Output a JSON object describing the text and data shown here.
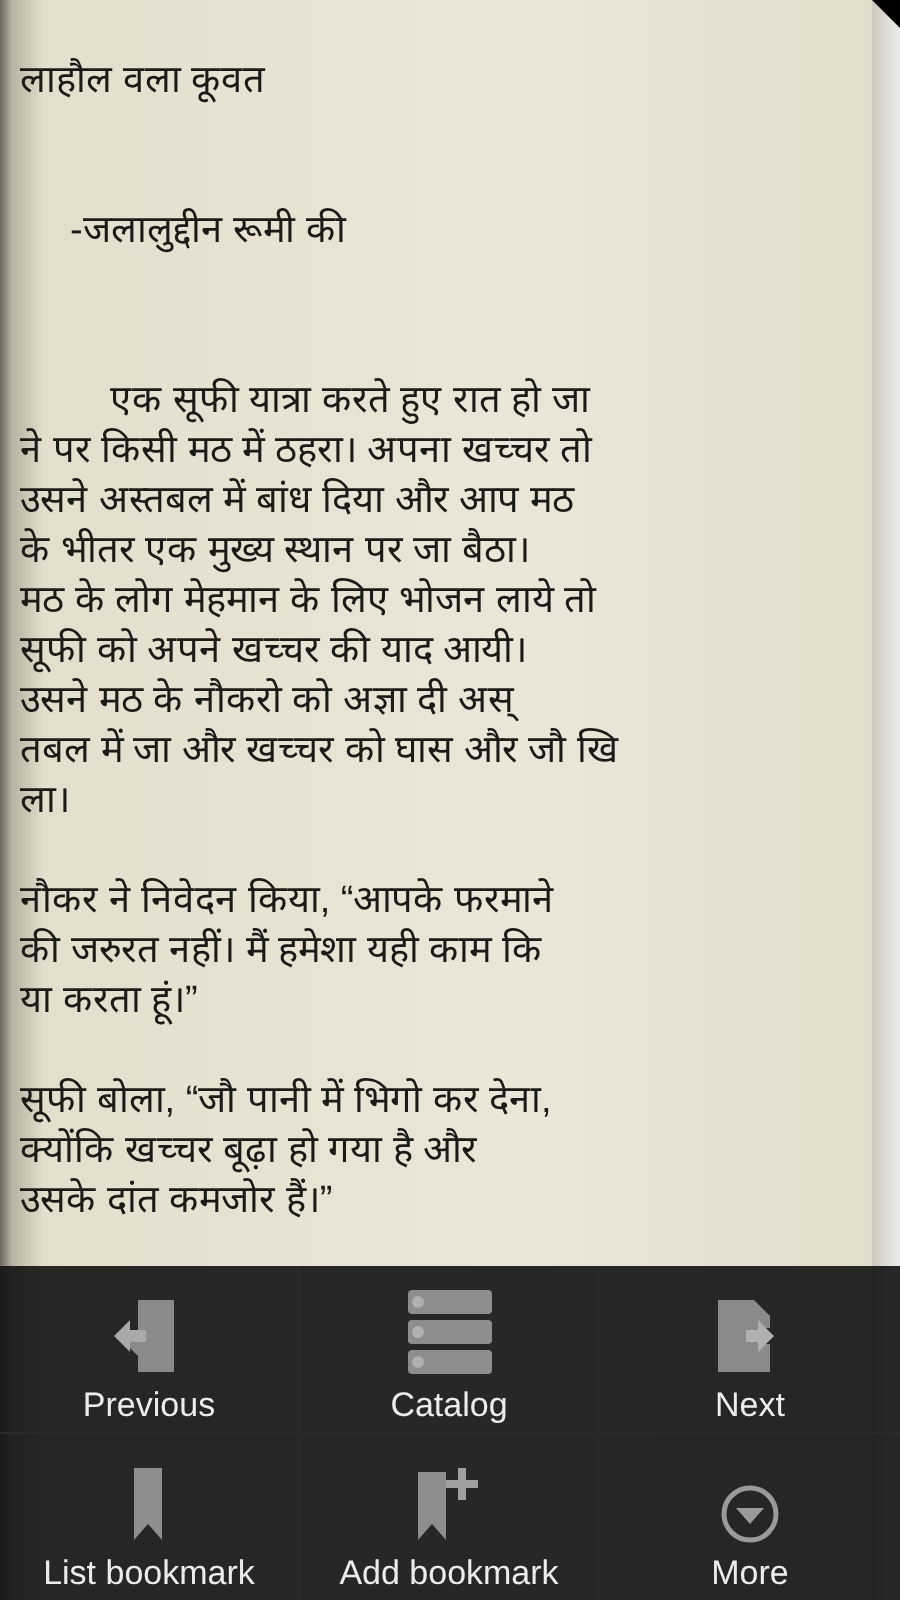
{
  "book": {
    "title": "लाहौल वला कूवत",
    "author": "-जलालुद्दीन रूमी की",
    "paragraphs": [
      {
        "indent": true,
        "lines": [
          "एक सूफी यात्रा करते हुए रात हो जा",
          "ने पर किसी मठ में ठहरा। अपना खच्चर तो",
          "उसने अस्तबल में बांध दिया और आप मठ",
          "के भीतर एक मुख्य स्थान पर जा बैठा।",
          "मठ के लोग मेहमान के लिए भोजन लाये तो",
          "सूफी को अपने खच्चर की याद आयी।",
          "उसने मठ के नौकरो को अज्ञा दी अस्",
          "तबल में जा और खच्चर को घास और जौ खि",
          "ला।"
        ]
      },
      {
        "indent": false,
        "lines": [
          "नौकर ने निवेदन किया, “आपके फरमाने",
          "की जरुरत नहीं। मैं हमेशा यही काम कि",
          "या करता हूं।”"
        ]
      },
      {
        "indent": false,
        "lines": [
          "सूफी बोला, “जौ पानी में भिगो कर देना,",
          "क्योंकि खच्चर बूढ़ा हो गया है और",
          "उसके दांत कमजोर हैं।”"
        ]
      }
    ]
  },
  "menu": [
    {
      "kind": "previous",
      "label": "Previous"
    },
    {
      "kind": "catalog",
      "label": "Catalog"
    },
    {
      "kind": "next",
      "label": "Next"
    },
    {
      "kind": "list-bookmark",
      "label": "List bookmark"
    },
    {
      "kind": "add-bookmark",
      "label": "Add bookmark"
    },
    {
      "kind": "more",
      "label": "More"
    }
  ]
}
